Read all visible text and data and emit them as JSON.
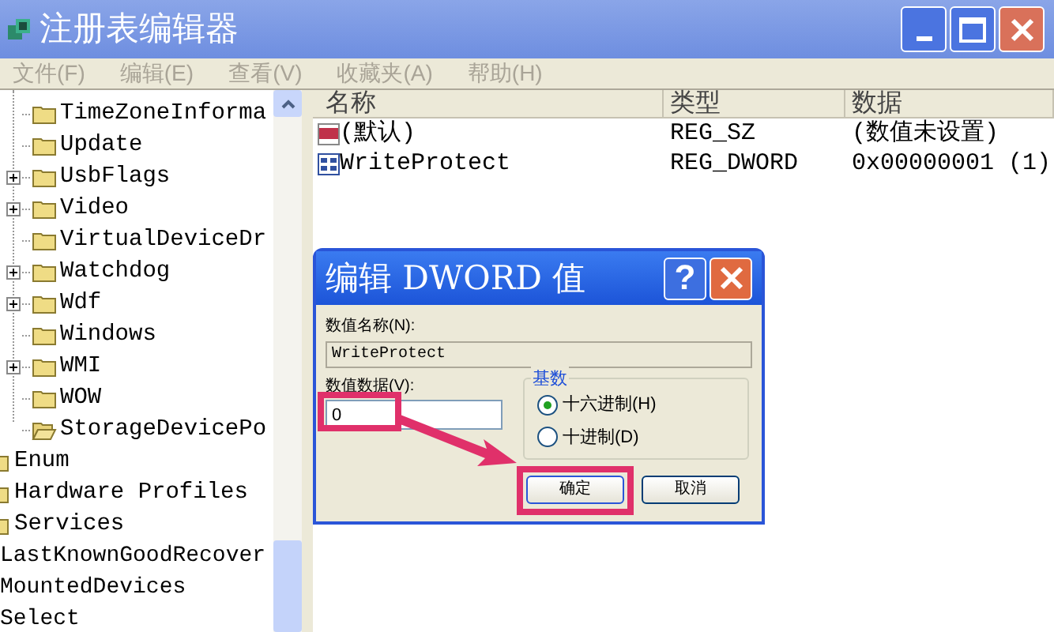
{
  "window": {
    "title": "注册表编辑器"
  },
  "menu": [
    "文件(F)",
    "编辑(E)",
    "查看(V)",
    "收藏夹(A)",
    "帮助(H)"
  ],
  "tree": {
    "subkeys": [
      {
        "label": "TimeZoneInforma",
        "expandable": false,
        "open": false
      },
      {
        "label": "Update",
        "expandable": false,
        "open": false
      },
      {
        "label": "UsbFlags",
        "expandable": true,
        "open": false
      },
      {
        "label": "Video",
        "expandable": true,
        "open": false
      },
      {
        "label": "VirtualDeviceDr",
        "expandable": false,
        "open": false
      },
      {
        "label": "Watchdog",
        "expandable": true,
        "open": false
      },
      {
        "label": "Wdf",
        "expandable": true,
        "open": false
      },
      {
        "label": "Windows",
        "expandable": false,
        "open": false
      },
      {
        "label": "WMI",
        "expandable": true,
        "open": false
      },
      {
        "label": "WOW",
        "expandable": false,
        "open": false
      },
      {
        "label": "StorageDevicePo",
        "expandable": false,
        "open": true
      }
    ],
    "keys": [
      "Enum",
      "Hardware Profiles",
      "Services"
    ],
    "keys_cut": [
      "LastKnownGoodRecover",
      "MountedDevices",
      "Select"
    ]
  },
  "values": {
    "columns": [
      "名称",
      "类型",
      "数据"
    ],
    "rows": [
      {
        "kind": "string",
        "name": "(默认)",
        "type": "REG_SZ",
        "data": "(数值未设置)"
      },
      {
        "kind": "binary",
        "name": "WriteProtect",
        "type": "REG_DWORD",
        "data": "0x00000001 (1)"
      }
    ]
  },
  "dialog": {
    "title": "编辑 DWORD 值",
    "help": "?",
    "name_label": "数值名称(N):",
    "name_value": "WriteProtect",
    "data_label": "数值数据(V):",
    "data_value": "0",
    "base": {
      "title": "基数",
      "options": [
        {
          "label": "十六进制(H)",
          "selected": true
        },
        {
          "label": "十进制(D)",
          "selected": false
        }
      ]
    },
    "buttons": [
      "确定",
      "取消"
    ]
  }
}
